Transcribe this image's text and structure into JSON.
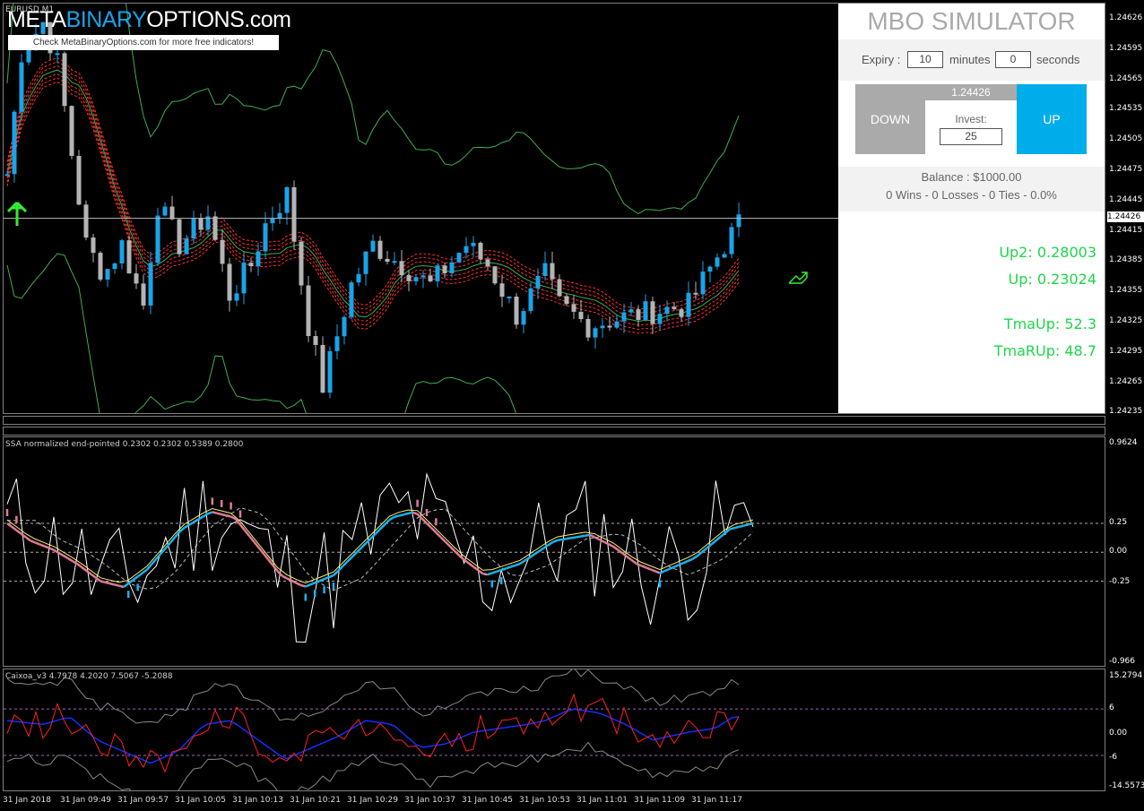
{
  "symbol": "EURUSD,M1",
  "logo": {
    "part1": "META",
    "part2": "BINARY",
    "part3": "OPTIONS",
    "part4": ".com",
    "tagline": "Check MetaBinaryOptions.com for more free indicators!"
  },
  "simulator": {
    "title": "MBO SIMULATOR",
    "expiry_label": "Expiry :",
    "minutes_value": "10",
    "minutes_label": "minutes",
    "seconds_value": "0",
    "seconds_label": "seconds",
    "down_label": "DOWN",
    "up_label": "UP",
    "price": "1.24426",
    "invest_label": "Invest:",
    "invest_value": "25",
    "balance": "Balance : $1000.00",
    "stats": "0 Wins - 0 Losses - 0 Ties - 0.0%",
    "indicators": [
      "Up2: 0.28003",
      "Up: 0.23024",
      "TmaUp: 52.3",
      "TmaRUp: 48.7"
    ]
  },
  "price_scale": [
    "1.24626",
    "1.24595",
    "1.24565",
    "1.24535",
    "1.24505",
    "1.24475",
    "1.24445",
    "1.24415",
    "1.24385",
    "1.24355",
    "1.24325",
    "1.24295",
    "1.24265",
    "1.24235"
  ],
  "current_price": "1.24426",
  "ssa": {
    "label": "SSA normalized end-pointed 0.2302 0.2302 0.5389 0.2800",
    "scale": [
      "0.9624",
      "0.25",
      "0.00",
      "0.00",
      "-0.25",
      "-0.966"
    ]
  },
  "caixoa": {
    "label": "Caixoa_v3 4.7978 4.2020 7.5067 -5.2088",
    "scale": [
      "15.2794",
      "6",
      "0.00",
      "-6",
      "-14.5573"
    ]
  },
  "time_labels": [
    "31 Jan 2018",
    "31 Jan 09:49",
    "31 Jan 09:57",
    "31 Jan 10:05",
    "31 Jan 10:13",
    "31 Jan 10:21",
    "31 Jan 10:29",
    "31 Jan 10:37",
    "31 Jan 10:45",
    "31 Jan 10:53",
    "31 Jan 11:01",
    "31 Jan 11:09",
    "31 Jan 11:17"
  ],
  "colors": {
    "bull": "#1aa3e8",
    "bear": "#b4b4b4",
    "band": "#3fae4f",
    "tma_mid": "#ff8a8a",
    "tma_env": "#ff3030",
    "ssa_up": "#19b3f0",
    "ssa_down": "#e07a9a",
    "caixoa_fast": "#ff2020",
    "caixoa_slow": "#1030ff"
  },
  "chart_data": [
    {
      "type": "candlestick",
      "title": "EURUSD,M1",
      "ylim": [
        1.24235,
        1.24635
      ],
      "x": [
        "31 Jan 2018",
        "31 Jan 09:49",
        "31 Jan 09:57",
        "31 Jan 10:05",
        "31 Jan 10:13",
        "31 Jan 10:21",
        "31 Jan 10:29",
        "31 Jan 10:37",
        "31 Jan 10:45",
        "31 Jan 10:53",
        "31 Jan 11:01",
        "31 Jan 11:09",
        "31 Jan 11:17"
      ],
      "closes": [
        1.2447,
        1.2459,
        1.2457,
        1.2455,
        1.2443,
        1.2438,
        1.2437,
        1.2434,
        1.2441,
        1.244,
        1.2437,
        1.2433,
        1.2433,
        1.2429,
        1.2436,
        1.244,
        1.244,
        1.2439,
        1.2437,
        1.2435,
        1.2435,
        1.2442
      ],
      "last": 1.24426
    }
  ]
}
